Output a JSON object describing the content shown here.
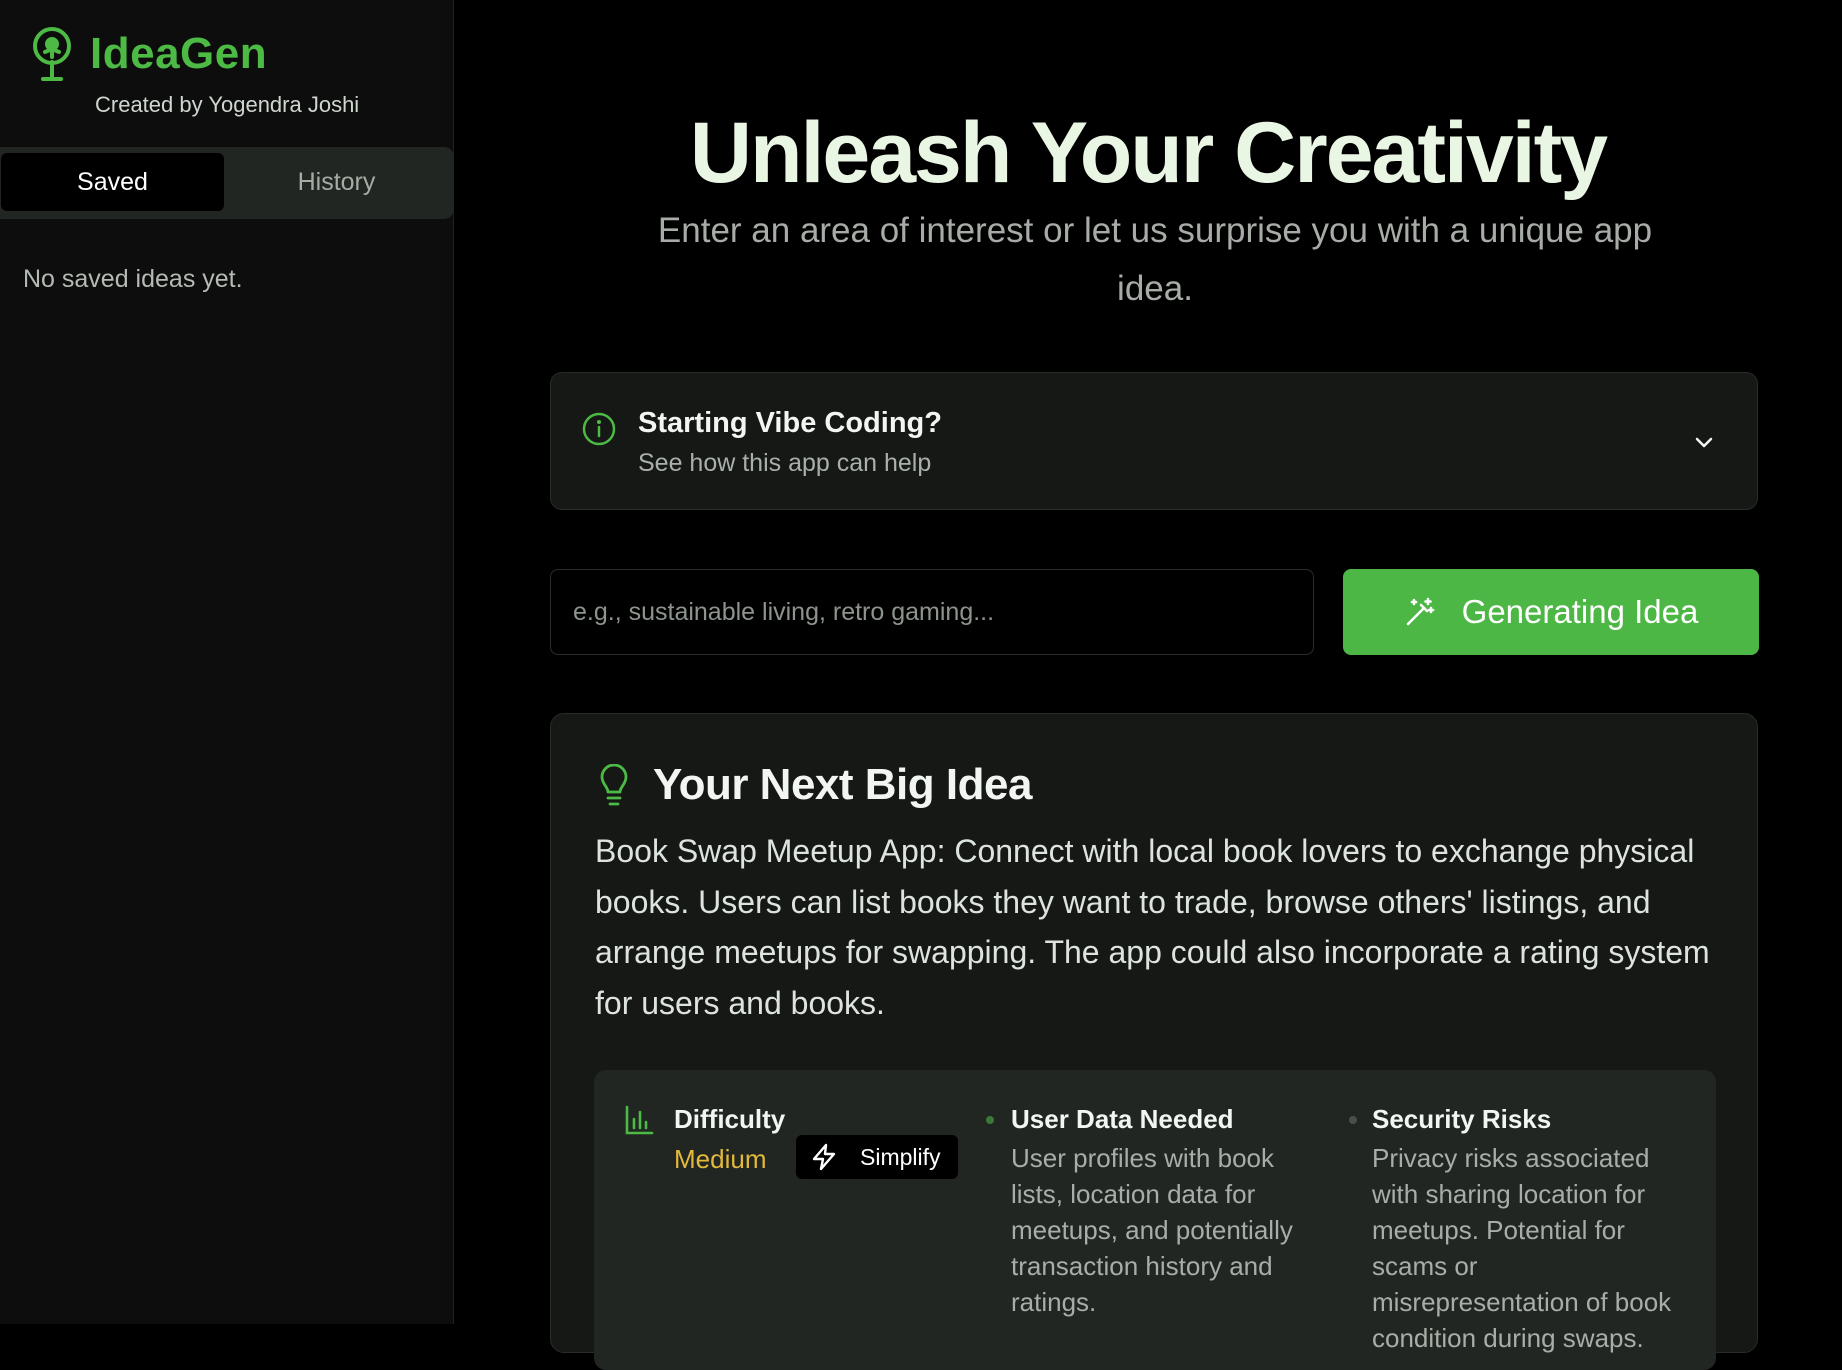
{
  "brand": {
    "name": "IdeaGen",
    "subtitle": "Created by Yogendra Joshi",
    "accent": "#4cba44"
  },
  "sidebar": {
    "tabs": [
      {
        "label": "Saved",
        "active": true
      },
      {
        "label": "History",
        "active": false
      }
    ],
    "empty_message": "No saved ideas yet."
  },
  "hero": {
    "title": "Unleash Your Creativity",
    "subtitle": "Enter an area of interest or let us surprise you with a unique app idea."
  },
  "info_card": {
    "title": "Starting Vibe Coding?",
    "subtitle": "See how this app can help",
    "icon": "info-icon"
  },
  "search": {
    "placeholder": "e.g., sustainable living, retro gaming...",
    "value": ""
  },
  "generate_button": {
    "label": "Generating Idea",
    "icon": "magic-wand-icon",
    "color": "#4cb744"
  },
  "result": {
    "title": "Your Next Big Idea",
    "text": "Book Swap Meetup App: Connect with local book lovers to exchange physical books. Users can list books they want to trade, browse others' listings, and arrange meetups for swapping. The app could also incorporate a rating system for users and books.",
    "difficulty": {
      "label": "Difficulty",
      "value": "Medium",
      "value_color": "#e2b93b",
      "simplify_label": "Simplify"
    },
    "user_data": {
      "title": "User Data Needed",
      "text": "User profiles with book lists, location data for meetups, and potentially transaction history and ratings."
    },
    "security": {
      "title": "Security Risks",
      "text": "Privacy risks associated with sharing location for meetups. Potential for scams or misrepresentation of book condition during swaps."
    }
  }
}
